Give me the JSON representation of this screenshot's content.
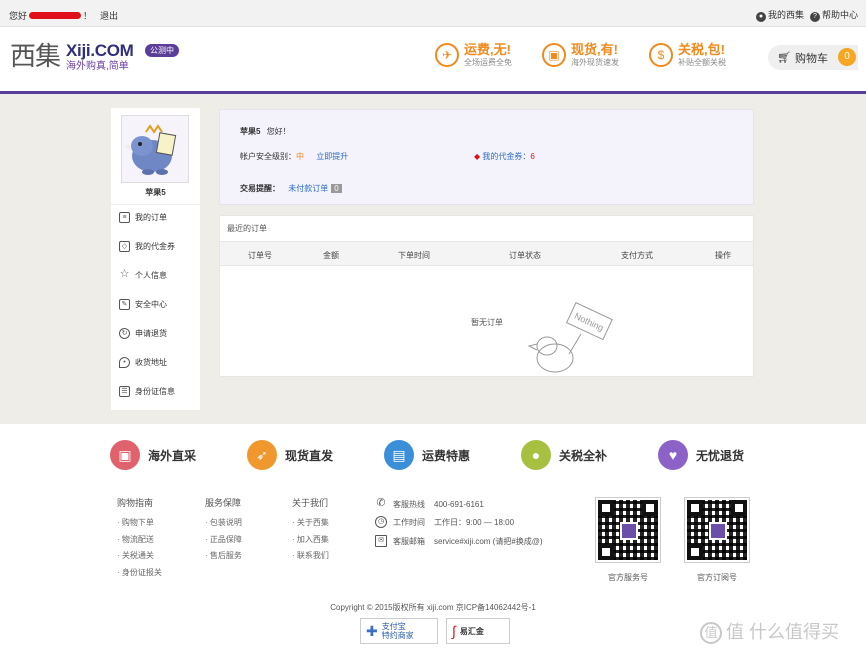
{
  "topbar": {
    "greeting": "您好",
    "exclaim": "！",
    "logout": "退出",
    "my_xiji": "我的西集",
    "help": "帮助中心"
  },
  "header": {
    "logo_cn": "西集",
    "logo_en": "Xiji.COM",
    "logo_sub": "海外购真,简单",
    "beta": "公测中",
    "features": [
      {
        "title": "运费,无!",
        "sub": "全场运费全免",
        "icon": "plane-icon"
      },
      {
        "title": "现货,有!",
        "sub": "海外现货速发",
        "icon": "box-icon"
      },
      {
        "title": "关税,包!",
        "sub": "补贴全额关税",
        "icon": "money-icon"
      }
    ],
    "cart_label": "购物车",
    "cart_count": "0"
  },
  "sidebar": {
    "username": "苹果5",
    "items": [
      {
        "label": "我的订单",
        "icon": "order-icon"
      },
      {
        "label": "我的代金券",
        "icon": "tag-icon"
      },
      {
        "label": "个人信息",
        "icon": "star-icon"
      },
      {
        "label": "安全中心",
        "icon": "edit-icon"
      },
      {
        "label": "申请退货",
        "icon": "refresh-icon"
      },
      {
        "label": "收货地址",
        "icon": "location-icon"
      },
      {
        "label": "身份证信息",
        "icon": "id-card-icon"
      }
    ]
  },
  "account": {
    "username": "苹果5",
    "hello": "您好！",
    "security_label": "帐户安全级别：",
    "security_level": "中",
    "upgrade": "立即提升",
    "coupon_label": "我的代金券：",
    "coupon_count": "6",
    "trade_label": "交易提醒：",
    "unpaid_label": "未付款订单",
    "unpaid_count": "0"
  },
  "orders": {
    "title": "最近的订单",
    "columns": [
      "订单号",
      "金额",
      "下单时间",
      "订单状态",
      "支付方式",
      "操作"
    ],
    "empty": "暂无订单",
    "empty_sign": "Nothing"
  },
  "services": [
    {
      "label": "海外直采",
      "color": "#e0626c"
    },
    {
      "label": "现货直发",
      "color": "#f0982e"
    },
    {
      "label": "运费特惠",
      "color": "#3a8fd8"
    },
    {
      "label": "关税全补",
      "color": "#a8c040"
    },
    {
      "label": "无忧退货",
      "color": "#8c62c8"
    }
  ],
  "footer": {
    "columns": [
      {
        "heading": "购物指南",
        "items": [
          "· 购物下单",
          "· 物流配送",
          "· 关税通关",
          "· 身份证报关"
        ]
      },
      {
        "heading": "服务保障",
        "items": [
          "· 包装说明",
          "· 正品保障",
          "· 售后服务"
        ]
      },
      {
        "heading": "关于我们",
        "items": [
          "· 关于西集",
          "· 加入西集",
          "· 联系我们"
        ]
      }
    ],
    "contact": [
      {
        "label": "客服热线",
        "value": "400-691-6161",
        "icon": "phone-icon"
      },
      {
        "label": "工作时间",
        "value": "工作日：9:00 — 18:00",
        "icon": "clock-icon"
      },
      {
        "label": "客服邮箱",
        "value": "service#xiji.com (请把#换成@)",
        "icon": "mail-icon"
      }
    ],
    "qr_captions": [
      "官方服务号",
      "官方订阅号"
    ],
    "copyright": "Copyright © 2015版权所有 xiji.com 京ICP备14062442号-1",
    "alipay": "支付宝\n特约商家",
    "yihuijin": "易汇金",
    "watermark": "值 什么值得买"
  }
}
